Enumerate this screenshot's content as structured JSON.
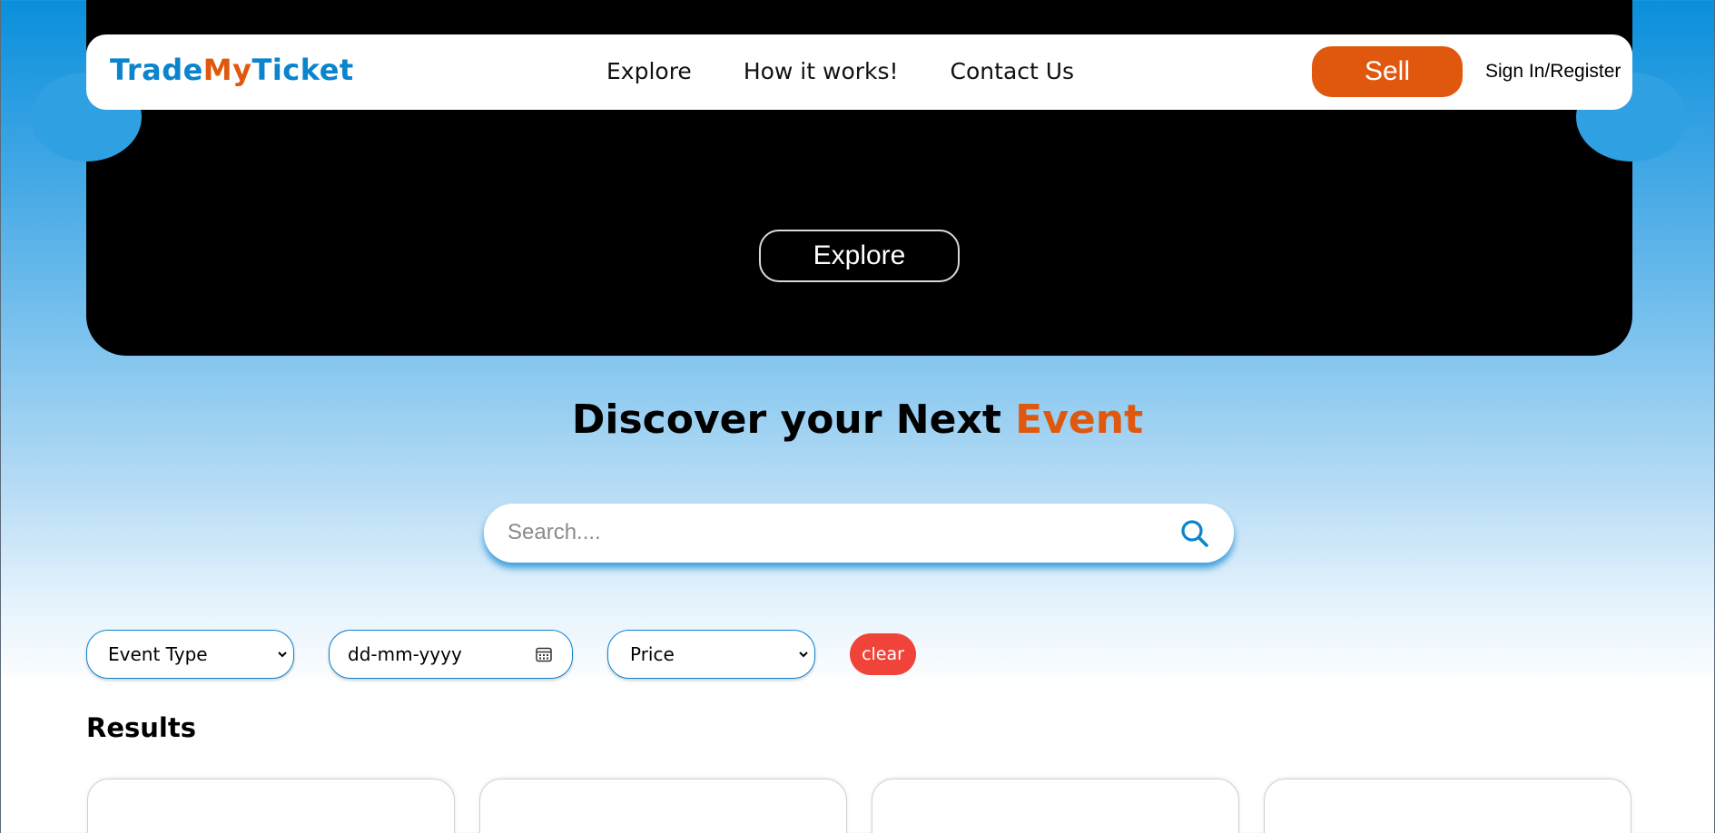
{
  "brand": {
    "logo_part1": "Trade",
    "logo_part2": "My",
    "logo_part3": "Ticket",
    "primary_color": "#0a84cc",
    "accent_color": "#e0580e"
  },
  "nav": {
    "links": [
      "Explore",
      "How it works!",
      "Contact Us"
    ],
    "sell_label": "Sell",
    "signin_label": "Sign In/Register"
  },
  "hero": {
    "explore_label": "Explore"
  },
  "heading": {
    "text_main": "Discover your Next ",
    "text_accent": "Event"
  },
  "search": {
    "placeholder": "Search....",
    "value": ""
  },
  "filters": {
    "event_type": "Event Type",
    "date": "dd-mm-yyyy",
    "price": "Price",
    "clear_label": "clear",
    "clear_color": "#f0443a"
  },
  "results": {
    "title": "Results",
    "card_count": 4
  },
  "icons": {
    "search": "search-icon",
    "calendar": "calendar-icon",
    "dropdown": "chevron-down-icon"
  }
}
